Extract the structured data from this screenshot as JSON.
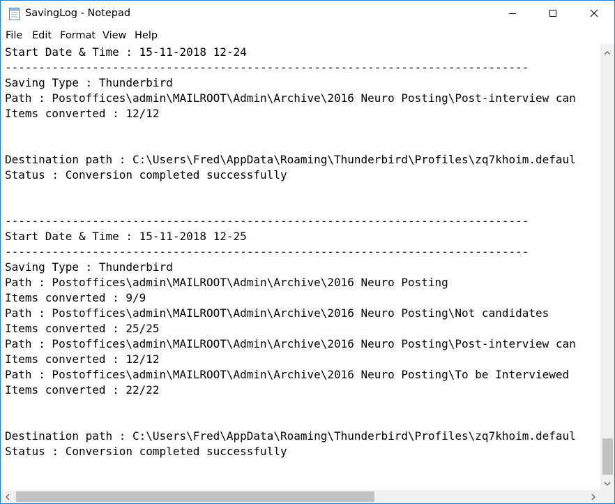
{
  "window": {
    "title": "SavingLog - Notepad",
    "accent_color": "#1883d7",
    "app_icon": "notepad-icon",
    "controls": [
      "minimize-icon",
      "maximize-icon",
      "close-icon"
    ]
  },
  "menu": {
    "file": "File",
    "edit": "Edit",
    "format": "Format",
    "view": "View",
    "help": "Help"
  },
  "editor": {
    "lines": [
      "Start Date & Time : 15-11-2018 12-24",
      "------------------------------------------------------------------------------",
      "Saving Type : Thunderbird",
      "Path : Postoffices\\admin\\MAILROOT\\Admin\\Archive\\2016 Neuro Posting\\Post-interview can",
      "Items converted : 12/12",
      "",
      "",
      "Destination path : C:\\Users\\Fred\\AppData\\Roaming\\Thunderbird\\Profiles\\zq7khoim.defaul",
      "Status : Conversion completed successfully",
      "",
      "",
      "------------------------------------------------------------------------------",
      "Start Date & Time : 15-11-2018 12-25",
      "------------------------------------------------------------------------------",
      "Saving Type : Thunderbird",
      "Path : Postoffices\\admin\\MAILROOT\\Admin\\Archive\\2016 Neuro Posting",
      "Items converted : 9/9",
      "Path : Postoffices\\admin\\MAILROOT\\Admin\\Archive\\2016 Neuro Posting\\Not candidates",
      "Items converted : 25/25",
      "Path : Postoffices\\admin\\MAILROOT\\Admin\\Archive\\2016 Neuro Posting\\Post-interview can",
      "Items converted : 12/12",
      "Path : Postoffices\\admin\\MAILROOT\\Admin\\Archive\\2016 Neuro Posting\\To be Interviewed",
      "Items converted : 22/22",
      "",
      "",
      "Destination path : C:\\Users\\Fred\\AppData\\Roaming\\Thunderbird\\Profiles\\zq7khoim.defaul",
      "Status : Conversion completed successfully"
    ]
  }
}
